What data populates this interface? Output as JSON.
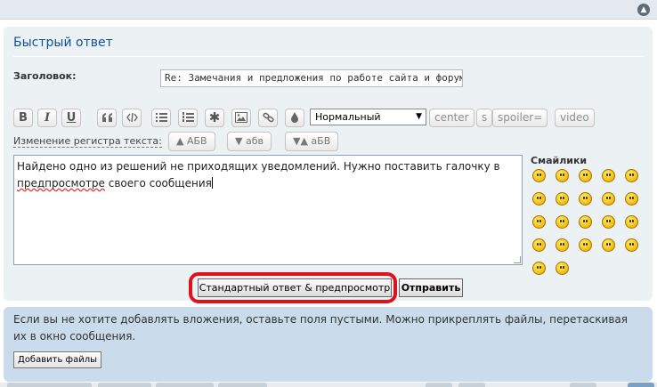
{
  "quick_reply": {
    "title": "Быстрый ответ",
    "collapse_icon": "chevron-up-icon"
  },
  "subject": {
    "label": "Заголовок:",
    "value": "Re: Замечания и предложения по работе сайта и форума"
  },
  "toolbar": {
    "buttons": [
      {
        "name": "bold",
        "label": "B",
        "icon": "bold-icon"
      },
      {
        "name": "italic",
        "label": "I",
        "icon": "italic-icon"
      },
      {
        "name": "underline",
        "label": "U",
        "icon": "underline-icon"
      },
      {
        "name": "quote",
        "icon": "quote-icon"
      },
      {
        "name": "code",
        "icon": "code-icon"
      },
      {
        "name": "list",
        "icon": "list-icon"
      },
      {
        "name": "numbered-list",
        "icon": "numbered-list-icon"
      },
      {
        "name": "list-item",
        "icon": "asterisk-icon"
      },
      {
        "name": "image",
        "icon": "image-icon"
      },
      {
        "name": "link",
        "icon": "link-icon"
      },
      {
        "name": "color",
        "icon": "droplet-icon"
      }
    ],
    "font_size_selected": "Нормальный",
    "text_buttons": [
      "center",
      "s",
      "spoiler=",
      "video"
    ]
  },
  "case_change": {
    "label": "Изменение регистра текста:",
    "buttons": [
      "▲ АБВ",
      "▼ абв",
      "▼▲ аБВ"
    ]
  },
  "message": {
    "line1": "Найдено одно из решений не приходящих уведомлений. Нужно поставить галочку в",
    "misspelled_word": "предпросмотре",
    "line2_rest": " своего сообщения"
  },
  "smilies": {
    "title": "Смайлики",
    "count": 22
  },
  "actions": {
    "preview_label": "Стандартный ответ & предпросмотр",
    "submit_label": "Отправить",
    "highlight_color": "#e0101c"
  },
  "attachments": {
    "note": "Если вы не хотите добавлять вложения, оставьте поля пустыми. Можно прикреплять файлы, перетаскивая их в окно сообщения.",
    "add_files_label": "Добавить файлы"
  },
  "colors": {
    "title": "#115098",
    "panel": "#ecf1f4",
    "attach_panel": "#cadceb"
  }
}
